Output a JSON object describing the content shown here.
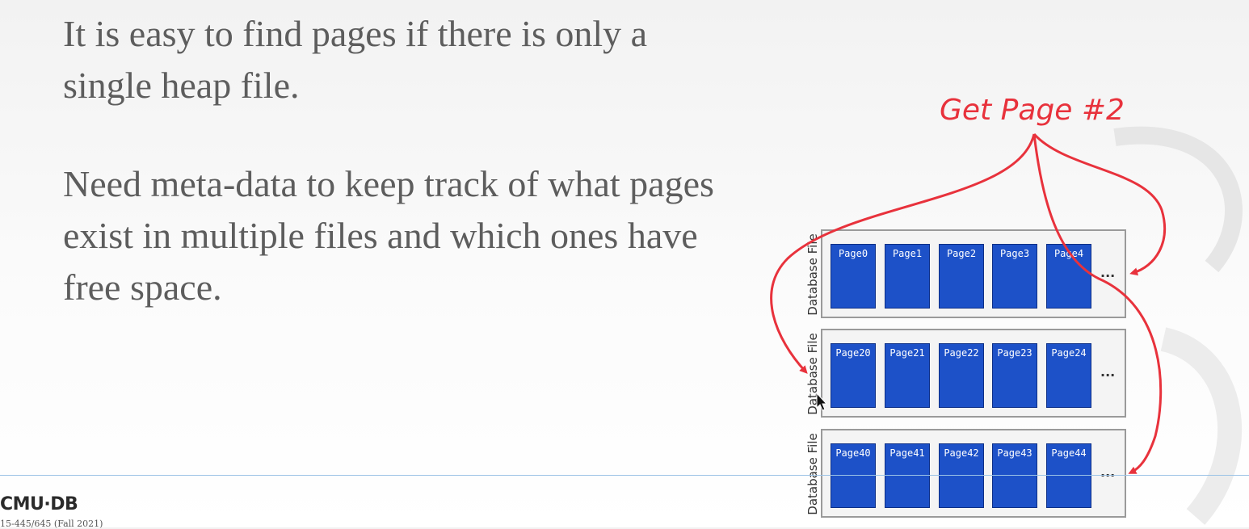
{
  "slide": {
    "bullets": [
      "It is easy to find pages if there is only a single heap file.",
      "Need meta-data to keep track of what pages exist in multiple files and which ones have free space."
    ],
    "callout": "Get Page #2",
    "files": [
      {
        "label": "Database File",
        "pages": [
          "Page0",
          "Page1",
          "Page2",
          "Page3",
          "Page4"
        ],
        "more": "..."
      },
      {
        "label": "Database File",
        "pages": [
          "Page20",
          "Page21",
          "Page22",
          "Page23",
          "Page24"
        ],
        "more": "..."
      },
      {
        "label": "Database File",
        "pages": [
          "Page40",
          "Page41",
          "Page42",
          "Page43",
          "Page44"
        ],
        "more": "..."
      }
    ]
  },
  "footer": {
    "logo": "CMU·DB",
    "course": "15-445/645 (Fall 2021)"
  },
  "colors": {
    "accent": "#e8323c",
    "page_fill": "#1d51c8",
    "text": "#5d5d5d"
  }
}
